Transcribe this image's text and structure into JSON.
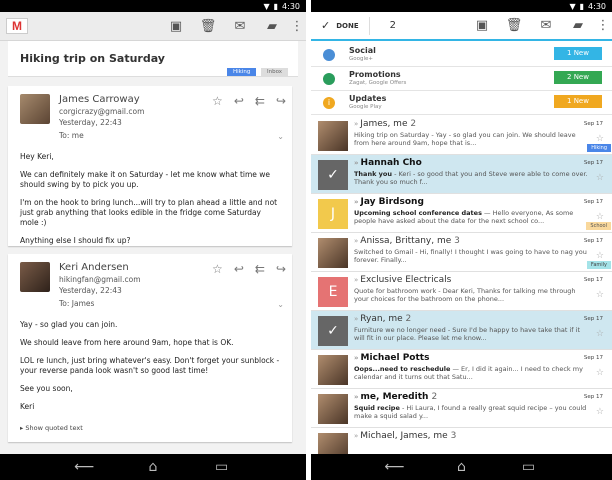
{
  "status": {
    "time": "4:30"
  },
  "left": {
    "logo": "M",
    "subject": "Hiking trip on Saturday",
    "labels": [
      {
        "text": "Hiking",
        "bg": "#4a86e8",
        "fg": "#ffffff"
      },
      {
        "text": "Inbox",
        "bg": "#dddddd",
        "fg": "#666666"
      }
    ],
    "messages": [
      {
        "sender": "James Carroway",
        "email": "corgicrazy@gmail.com",
        "time": "Yesterday, 22:43",
        "to": "To: me",
        "paragraphs": [
          "Hey Keri,",
          "We can definitely make it on Saturday - let me know what time we should swing by to pick you up.",
          "I'm on the hook to bring lunch...will try to plan ahead a little and not just grab anything that looks edible in the fridge come Saturday mole :)",
          "Anything else I should fix up?"
        ]
      },
      {
        "sender": "Keri Andersen",
        "email": "hikingfan@gmail.com",
        "time": "Yesterday, 22:43",
        "to": "To: James",
        "paragraphs": [
          "Yay - so glad you can join.",
          "We should leave from here around 9am, hope that is OK.",
          "LOL re lunch, just bring whatever's easy. Don't forget your sunblock - your reverse panda look wasn't so good last time!",
          "See you soon,",
          "Keri"
        ],
        "show_quoted": "Show quoted text"
      }
    ]
  },
  "right": {
    "done_label": "DONE",
    "selected_count": "2",
    "categories": [
      {
        "name": "Social",
        "sub": "Google+",
        "badge": "1 New",
        "badge_color": "#33b5e5",
        "icon_color": "#4a8ed6",
        "icon": "person-group-icon"
      },
      {
        "name": "Promotions",
        "sub": "Zagat, Google Offers",
        "badge": "2 New",
        "badge_color": "#34a853",
        "icon_color": "#2a9d5c",
        "icon": "tag-icon"
      },
      {
        "name": "Updates",
        "sub": "Google Play",
        "badge": "1 New",
        "badge_color": "#f0a820",
        "icon_color": "#f0a820",
        "icon": "info-icon"
      }
    ],
    "messages": [
      {
        "from": "James, me",
        "count": "2",
        "bold_part": "",
        "preview": "Hiking trip on Saturday - Yay - so glad you can join. We should leave from here around 9am, hope that is...",
        "date": "Sep 17",
        "label": "Hiking",
        "label_bg": "#4a86e8",
        "label_fg": "#ffffff",
        "avatar_color": "#8a6a50",
        "avatar_text": "",
        "selected": false,
        "unread": false,
        "chev": "»"
      },
      {
        "from": "Hannah Cho",
        "count": "",
        "bold_part": "Thank you",
        "preview": " - Keri - so good that you and Steve were able to come over. Thank you so much f...",
        "date": "Sep 17",
        "label": "",
        "label_bg": "",
        "label_fg": "",
        "avatar_color": "#666666",
        "avatar_text": "✓",
        "selected": true,
        "unread": true,
        "chev": "»"
      },
      {
        "from": "Jay Birdsong",
        "count": "",
        "bold_part": "Upcoming school conference dates",
        "preview": " — Hello everyone, As some people have asked about the date for the next school co...",
        "date": "Sep 17",
        "label": "School",
        "label_bg": "#f9d89c",
        "label_fg": "#555555",
        "avatar_color": "#f2c94c",
        "avatar_text": "J",
        "selected": false,
        "unread": true,
        "chev": "»"
      },
      {
        "from": "Anissa, Brittany, me",
        "count": "3",
        "bold_part": "",
        "preview": "Switched to Gmail - Hi, finally! I thought I was going to have to nag you forever. Finally...",
        "date": "Sep 17",
        "label": "Family",
        "label_bg": "#a4e3e8",
        "label_fg": "#444444",
        "avatar_color": "#8a6a50",
        "avatar_text": "",
        "selected": false,
        "unread": false,
        "chev": "»"
      },
      {
        "from": "Exclusive Electricals",
        "count": "",
        "bold_part": "",
        "preview": "Quote for bathroom work - Dear Keri, Thanks for talking me through your choices for the bathroom on the phone...",
        "date": "Sep 17",
        "label": "",
        "label_bg": "",
        "label_fg": "",
        "avatar_color": "#e57373",
        "avatar_text": "E",
        "selected": false,
        "unread": false,
        "chev": "»"
      },
      {
        "from": "Ryan, me",
        "count": "2",
        "bold_part": "",
        "preview": "Furniture we no longer need - Sure I'd be happy to have take that if it will fit in our place. Please let me know...",
        "date": "Sep 17",
        "label": "",
        "label_bg": "",
        "label_fg": "",
        "avatar_color": "#666666",
        "avatar_text": "✓",
        "selected": true,
        "unread": false,
        "chev": "»"
      },
      {
        "from": "Michael Potts",
        "count": "",
        "bold_part": "Oops...need to reschedule",
        "preview": " — Er, I did it again... I need to check my calendar and it turns out that Satu...",
        "date": "Sep 17",
        "label": "",
        "label_bg": "",
        "label_fg": "",
        "avatar_color": "#8a6a50",
        "avatar_text": "",
        "selected": false,
        "unread": true,
        "chev": "»"
      },
      {
        "from": "me, Meredith",
        "count": "2",
        "bold_part": "Squid recipe",
        "preview": " - Hi Laura, I found a really great squid recipe – you could make a squid salad y...",
        "date": "Sep 17",
        "label": "",
        "label_bg": "",
        "label_fg": "",
        "avatar_color": "#8a6a50",
        "avatar_text": "",
        "selected": false,
        "unread": true,
        "chev": "»"
      },
      {
        "from": "Michael, James, me",
        "count": "3",
        "bold_part": "",
        "preview": "",
        "date": "",
        "label": "",
        "label_bg": "",
        "label_fg": "",
        "avatar_color": "#8a6a50",
        "avatar_text": "",
        "selected": false,
        "unread": false,
        "chev": "»"
      }
    ]
  }
}
